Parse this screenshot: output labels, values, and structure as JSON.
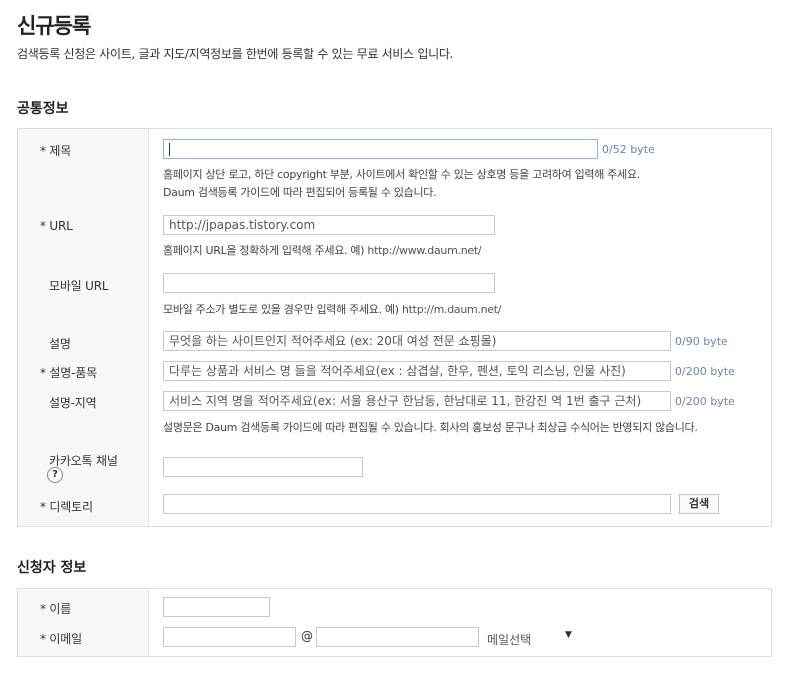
{
  "header": {
    "title": "신규등록",
    "description": "검색등록 신청은 사이트, 글과 지도/지역정보를 한번에 등록할 수 있는 무료 서비스 입니다."
  },
  "common": {
    "section_title": "공통정보",
    "title_field": {
      "label": "제목",
      "value": "",
      "counter": "0/52 byte",
      "help1": "홈페이지 상단 로고, 하단 copyright 부분, 사이트에서 확인할 수 있는 상호명 등을 고려하여 입력해 주세요.",
      "help2": "Daum 검색등록 가이드에 따라 편집되어 등록될 수 있습니다."
    },
    "url_field": {
      "label": "URL",
      "value": "http://jpapas.tistory.com",
      "help_text": "홈페이지 URL을 정확하게 입력해 주세요. 예)",
      "help_example": "http://www.daum.net/"
    },
    "mobile_url_field": {
      "label": "모바일 URL",
      "value": "",
      "help_text": "모바일 주소가 별도로 있을 경우만 입력해 주세요. 예)",
      "help_example": "http://m.daum.net/"
    },
    "desc_field": {
      "label": "설명",
      "placeholder": "무엇을 하는 사이트인지 적어주세요 (ex: 20대 여성 전문 쇼핑몰)",
      "counter": "0/90 byte"
    },
    "desc_items_field": {
      "label": "설명-품목",
      "placeholder": "다루는 상품과 서비스 명 들을 적어주세요(ex : 삼겹살, 한우, 펜션, 토익 리스닝, 인물 사진)",
      "counter": "0/200 byte"
    },
    "desc_region_field": {
      "label": "설명-지역",
      "placeholder": "서비스 지역 명을 적어주세요(ex: 서울  용산구 한남동, 한남대로 11, 한강진 역 1번 출구 근처)",
      "counter": "0/200 byte",
      "help": "설명문은 Daum 검색등록 가이드에 따라 편집될 수 있습니다. 회사의 홍보성 문구나 최상급 수식어는 반영되지 않습니다."
    },
    "kakao_field": {
      "label": "카카오톡 채널",
      "help_icon": "?",
      "value": ""
    },
    "directory_field": {
      "label": "디렉토리",
      "value": "",
      "search_button": "검색"
    }
  },
  "applicant": {
    "section_title": "신청자 정보",
    "name_field": {
      "label": "이름",
      "value": ""
    },
    "email_field": {
      "label": "이메일",
      "local_value": "",
      "at_symbol": "@",
      "domain_value": "",
      "select_label": "메일선택",
      "select_arrow": "▼"
    }
  },
  "colors": {
    "counter": "#6f84a8",
    "focus_border": "#8fb3e6",
    "label_column_bg": "#f8f8f8"
  }
}
